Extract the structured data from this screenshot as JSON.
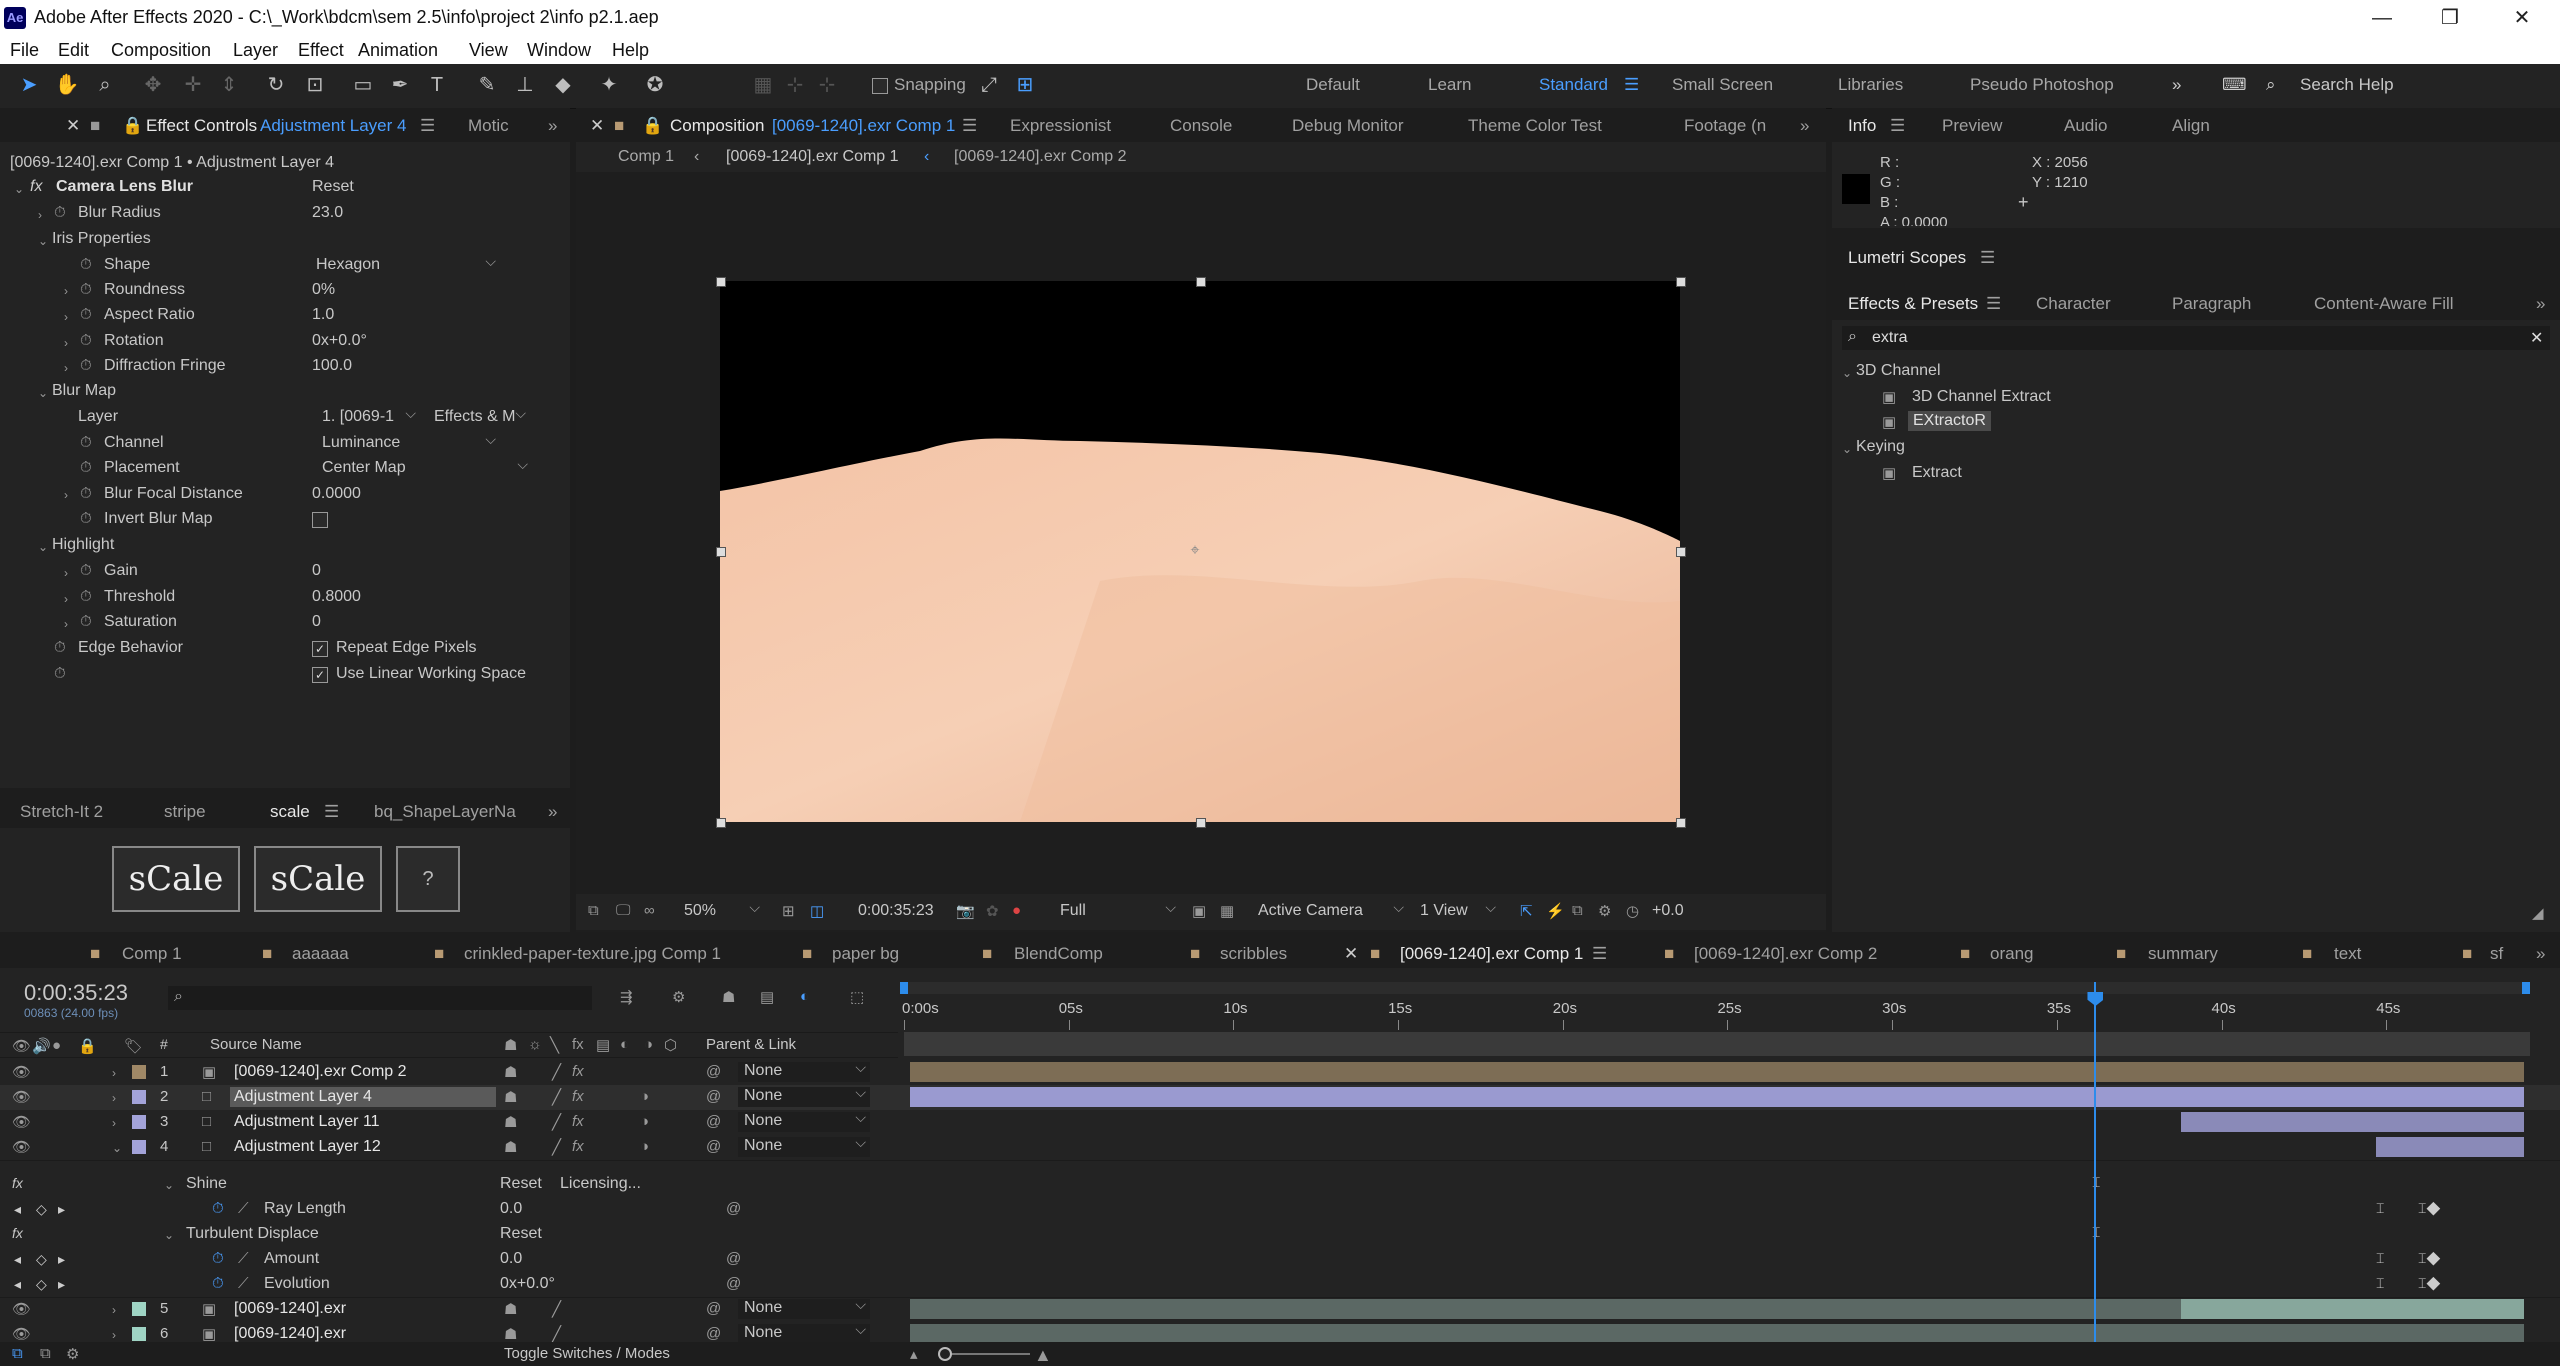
{
  "app": {
    "logo": "Ae",
    "title": "Adobe After Effects 2020 - C:\\_Work\\bdcm\\sem 2.5\\info\\project 2\\info p2.1.aep"
  },
  "menu": [
    "File",
    "Edit",
    "Composition",
    "Layer",
    "Effect",
    "Animation",
    "View",
    "Window",
    "Help"
  ],
  "toolbar": {
    "snapping_label": "Snapping",
    "workspaces": [
      "Default",
      "Learn",
      "Standard",
      "Small Screen",
      "Libraries",
      "Pseudo Photoshop"
    ],
    "active_workspace": "Standard",
    "search_placeholder": "Search Help"
  },
  "effect_controls": {
    "tabs": [
      "Effect Controls",
      "Adjustment Layer 4",
      "Motic"
    ],
    "breadcrumb": "[0069-1240].exr Comp 1 • Adjustment Layer 4",
    "effect_name": "Camera Lens Blur",
    "reset": "Reset",
    "rows": [
      {
        "label": "Blur Radius",
        "value": "23.0"
      },
      {
        "label": "Iris Properties",
        "value": ""
      },
      {
        "label": "Shape",
        "value": "Hexagon"
      },
      {
        "label": "Roundness",
        "value": "0%"
      },
      {
        "label": "Aspect Ratio",
        "value": "1.0"
      },
      {
        "label": "Rotation",
        "value": "0x+0.0°"
      },
      {
        "label": "Diffraction Fringe",
        "value": "100.0"
      },
      {
        "label": "Blur Map",
        "value": ""
      },
      {
        "label": "Layer",
        "value": "1. [0069-1"
      },
      {
        "label": "Channel",
        "value": "Luminance"
      },
      {
        "label": "Placement",
        "value": "Center Map"
      },
      {
        "label": "Blur Focal Distance",
        "value": "0.0000"
      },
      {
        "label": "Invert Blur Map",
        "value": ""
      },
      {
        "label": "Highlight",
        "value": ""
      },
      {
        "label": "Gain",
        "value": "0"
      },
      {
        "label": "Threshold",
        "value": "0.8000"
      },
      {
        "label": "Saturation",
        "value": "0"
      },
      {
        "label": "Edge Behavior",
        "value": "Repeat Edge Pixels"
      }
    ],
    "layer_source": "Effects & M",
    "linear_ws": "Use Linear Working Space"
  },
  "scripts_panel": {
    "tabs": [
      "Stretch-It 2",
      "stripe",
      "scale",
      "bq_ShapeLayerNa"
    ],
    "active_tab": "scale",
    "buttons": [
      "sCale",
      "sCale",
      "?"
    ]
  },
  "composition": {
    "tabs": [
      "Composition",
      "[0069-1240].exr Comp 1",
      "Expressionist",
      "Console",
      "Debug Monitor",
      "Theme Color Test",
      "Footage (n"
    ],
    "flow": [
      "Comp 1",
      "[0069-1240].exr Comp 1",
      "[0069-1240].exr Comp 2"
    ],
    "zoom": "50%",
    "timecode": "0:00:35:23",
    "resolution": "Full",
    "camera": "Active Camera",
    "views": "1 View",
    "exposure": "+0.0"
  },
  "info": {
    "tabs": [
      "Info",
      "Preview",
      "Audio",
      "Align"
    ],
    "r": "R :",
    "g": "G :",
    "b": "B :",
    "a": "A : 0.0000",
    "x": "X : 2056",
    "y": "Y : 1210"
  },
  "lumetri": {
    "title": "Lumetri Scopes"
  },
  "effects_presets": {
    "tabs": [
      "Effects & Presets",
      "Character",
      "Paragraph",
      "Content-Aware Fill"
    ],
    "search": "extra",
    "groups": [
      {
        "name": "3D Channel",
        "items": [
          "3D Channel Extract",
          "EXtractoR"
        ]
      },
      {
        "name": "Keying",
        "items": [
          "Extract"
        ]
      }
    ],
    "selected_item": "EXtractoR"
  },
  "timeline": {
    "tabs": [
      "Comp 1",
      "aaaaaa",
      "crinkled-paper-texture.jpg Comp 1",
      "paper bg",
      "BlendComp",
      "scribbles",
      "[0069-1240].exr Comp 1",
      "[0069-1240].exr Comp 2",
      "orang",
      "summary",
      "text",
      "sf"
    ],
    "active_tab": "[0069-1240].exr Comp 1",
    "timecode": "0:00:35:23",
    "frame_info": "00863 (24.00 fps)",
    "col_hash": "#",
    "col_source": "Source Name",
    "col_parent": "Parent & Link",
    "ruler": [
      "0:00s",
      "05s",
      "10s",
      "15s",
      "20s",
      "25s",
      "30s",
      "35s",
      "40s",
      "45s"
    ],
    "playhead_seconds": 35.96,
    "duration_seconds": 49,
    "layers": [
      {
        "num": "1",
        "name": "[0069-1240].exr Comp 2",
        "parent": "None",
        "color": "#a08866",
        "in": 0,
        "out": 49
      },
      {
        "num": "2",
        "name": "Adjustment Layer 4",
        "parent": "None",
        "color": "#a3a3d9",
        "in": 0,
        "out": 49
      },
      {
        "num": "3",
        "name": "Adjustment Layer 11",
        "parent": "None",
        "color": "#a3a3d9",
        "in": 38.6,
        "out": 49
      },
      {
        "num": "4",
        "name": "Adjustment Layer 12",
        "parent": "None",
        "color": "#a3a3d9",
        "in": 44.5,
        "out": 49
      },
      {
        "num": "5",
        "name": "[0069-1240].exr",
        "parent": "None",
        "color": "#9fd4c4",
        "in": 0,
        "out": 49
      },
      {
        "num": "6",
        "name": "[0069-1240].exr",
        "parent": "None",
        "color": "#9fd4c4",
        "in": 0,
        "out": 49
      }
    ],
    "effects": {
      "shine": {
        "name": "Shine",
        "reset": "Reset",
        "licensing": "Licensing...",
        "prop": "Ray Length",
        "value": "0.0"
      },
      "turbulent": {
        "name": "Turbulent Displace",
        "reset": "Reset",
        "props": [
          {
            "label": "Amount",
            "value": "0.0"
          },
          {
            "label": "Evolution",
            "value": "0x+0.0°"
          }
        ]
      }
    },
    "toggle_label": "Toggle Switches / Modes"
  }
}
